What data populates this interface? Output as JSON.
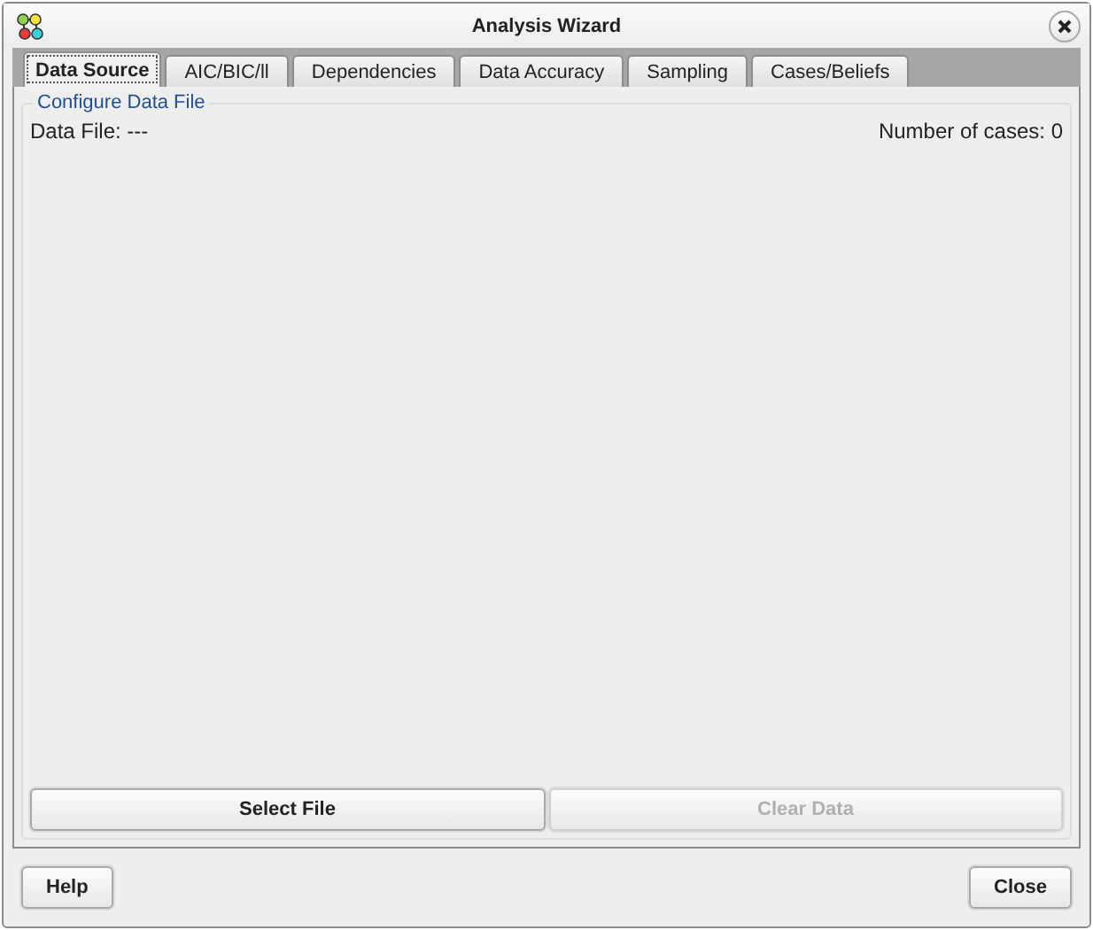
{
  "window": {
    "title": "Analysis Wizard"
  },
  "tabs": [
    {
      "label": "Data Source",
      "selected": true
    },
    {
      "label": "AIC/BIC/ll",
      "selected": false
    },
    {
      "label": "Dependencies",
      "selected": false
    },
    {
      "label": "Data Accuracy",
      "selected": false
    },
    {
      "label": "Sampling",
      "selected": false
    },
    {
      "label": "Cases/Beliefs",
      "selected": false
    }
  ],
  "group": {
    "title": "Configure Data File",
    "data_file": "Data File: ---",
    "cases": "Number of cases: 0"
  },
  "actions": [
    {
      "label": "Select File",
      "disabled": false
    },
    {
      "label": "Clear Data",
      "disabled": true
    }
  ],
  "footer": {
    "left": "Help",
    "right": "Close"
  }
}
